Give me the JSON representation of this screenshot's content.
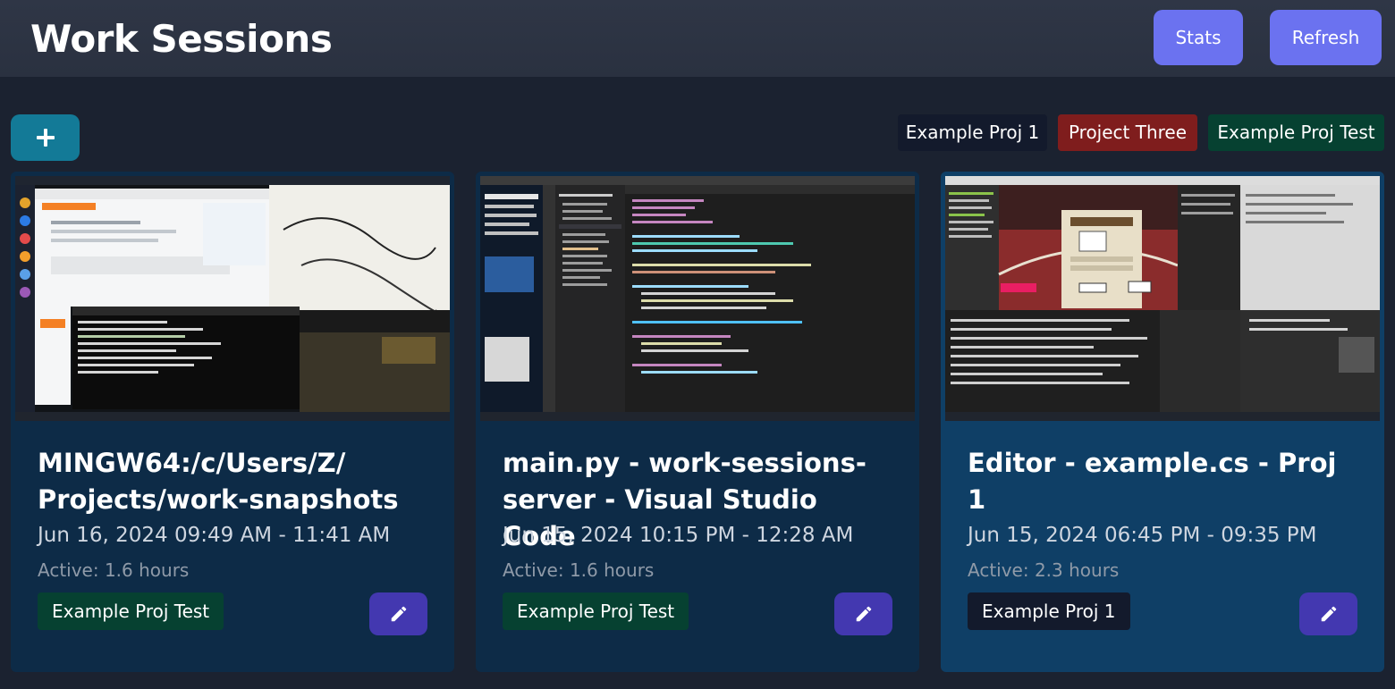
{
  "app": {
    "title": "Work Sessions",
    "stats_label": "Stats",
    "refresh_label": "Refresh",
    "add_icon": "plus-icon"
  },
  "project_filters": [
    {
      "label": "Example Proj 1",
      "color": "#131a2c"
    },
    {
      "label": "Project Three",
      "color": "#7f1d1d"
    },
    {
      "label": "Example Proj Test",
      "color": "#064131"
    }
  ],
  "sessions": [
    {
      "title": "MINGW64:/c/Users/Z/ Projects/work-snapshots",
      "time_range": "Jun 16, 2024 09:49 AM - 11:41 AM",
      "active": "Active: 1.6 hours",
      "project": "Example Proj Test",
      "project_color": "#064131",
      "thumbnail": "stackoverflow-terminal-youtube-screenshot",
      "edit_icon": "pencil-icon"
    },
    {
      "title": "main.py - work-sessions- server - Visual Studio Code",
      "time_range": "Jun 15, 2024 10:15 PM - 12:28 AM",
      "active": "Active: 1.6 hours",
      "project": "Example Proj Test",
      "project_color": "#064131",
      "thumbnail": "vscode-editor-screenshot",
      "edit_icon": "pencil-icon"
    },
    {
      "title": "Editor - example.cs - Proj 1",
      "time_range": "Jun 15, 2024 06:45 PM - 09:35 PM",
      "active": "Active: 2.3 hours",
      "project": "Example Proj 1",
      "project_color": "#131a2c",
      "thumbnail": "game-editor-screenshot",
      "edit_icon": "pencil-icon"
    }
  ]
}
